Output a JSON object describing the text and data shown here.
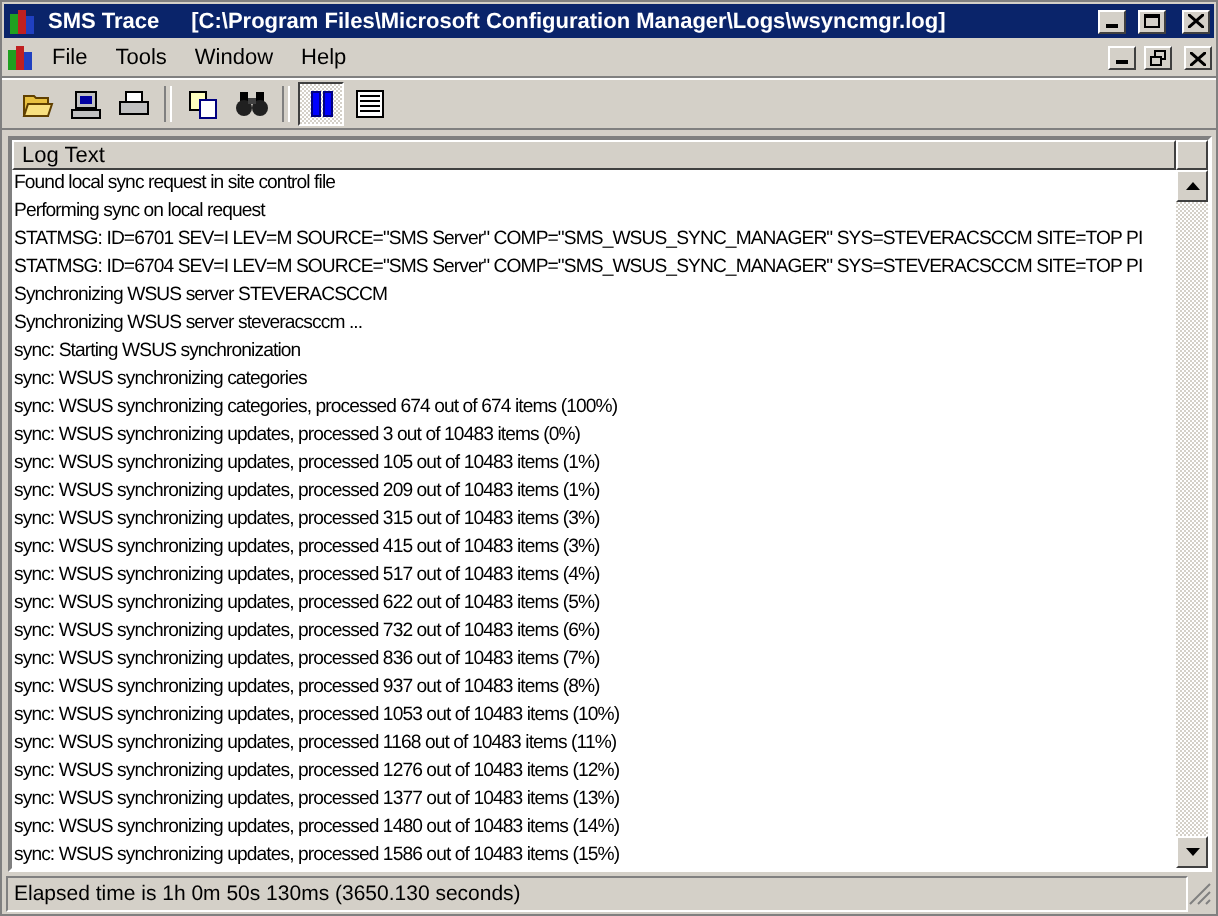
{
  "window": {
    "app_name": "SMS Trace",
    "file_path": "[C:\\Program Files\\Microsoft Configuration Manager\\Logs\\wsyncmgr.log]"
  },
  "menu": [
    "File",
    "Tools",
    "Window",
    "Help"
  ],
  "toolbar": [
    {
      "kind": "open",
      "pressed": false
    },
    {
      "kind": "computer",
      "pressed": false
    },
    {
      "kind": "print",
      "pressed": false
    },
    {
      "kind": "separator"
    },
    {
      "kind": "copy",
      "pressed": false
    },
    {
      "kind": "find",
      "pressed": false
    },
    {
      "kind": "separator"
    },
    {
      "kind": "pause",
      "pressed": true
    },
    {
      "kind": "list",
      "pressed": false
    }
  ],
  "table": {
    "columns": [
      "Log Text"
    ],
    "rows": [
      "Found local sync request in site control file",
      "Performing sync on local request",
      "STATMSG: ID=6701 SEV=I LEV=M SOURCE=\"SMS Server\" COMP=\"SMS_WSUS_SYNC_MANAGER\" SYS=STEVERACSCCM SITE=TOP PI",
      "STATMSG: ID=6704 SEV=I LEV=M SOURCE=\"SMS Server\" COMP=\"SMS_WSUS_SYNC_MANAGER\" SYS=STEVERACSCCM SITE=TOP PI",
      "Synchronizing WSUS server STEVERACSCCM",
      "Synchronizing WSUS server steveracsccm ...",
      "sync: Starting WSUS synchronization",
      "sync: WSUS synchronizing categories",
      "sync: WSUS synchronizing categories, processed 674 out of 674 items (100%)",
      "sync: WSUS synchronizing updates, processed 3 out of 10483 items (0%)",
      "sync: WSUS synchronizing updates, processed 105 out of 10483 items (1%)",
      "sync: WSUS synchronizing updates, processed 209 out of 10483 items (1%)",
      "sync: WSUS synchronizing updates, processed 315 out of 10483 items (3%)",
      "sync: WSUS synchronizing updates, processed 415 out of 10483 items (3%)",
      "sync: WSUS synchronizing updates, processed 517 out of 10483 items (4%)",
      "sync: WSUS synchronizing updates, processed 622 out of 10483 items (5%)",
      "sync: WSUS synchronizing updates, processed 732 out of 10483 items (6%)",
      "sync: WSUS synchronizing updates, processed 836 out of 10483 items (7%)",
      "sync: WSUS synchronizing updates, processed 937 out of 10483 items (8%)",
      "sync: WSUS synchronizing updates, processed 1053 out of 10483 items (10%)",
      "sync: WSUS synchronizing updates, processed 1168 out of 10483 items (11%)",
      "sync: WSUS synchronizing updates, processed 1276 out of 10483 items (12%)",
      "sync: WSUS synchronizing updates, processed 1377 out of 10483 items (13%)",
      "sync: WSUS synchronizing updates, processed 1480 out of 10483 items (14%)",
      "sync: WSUS synchronizing updates, processed 1586 out of 10483 items (15%)"
    ]
  },
  "status_bar": "Elapsed time is 1h 0m 50s 130ms (3650.130 seconds)"
}
